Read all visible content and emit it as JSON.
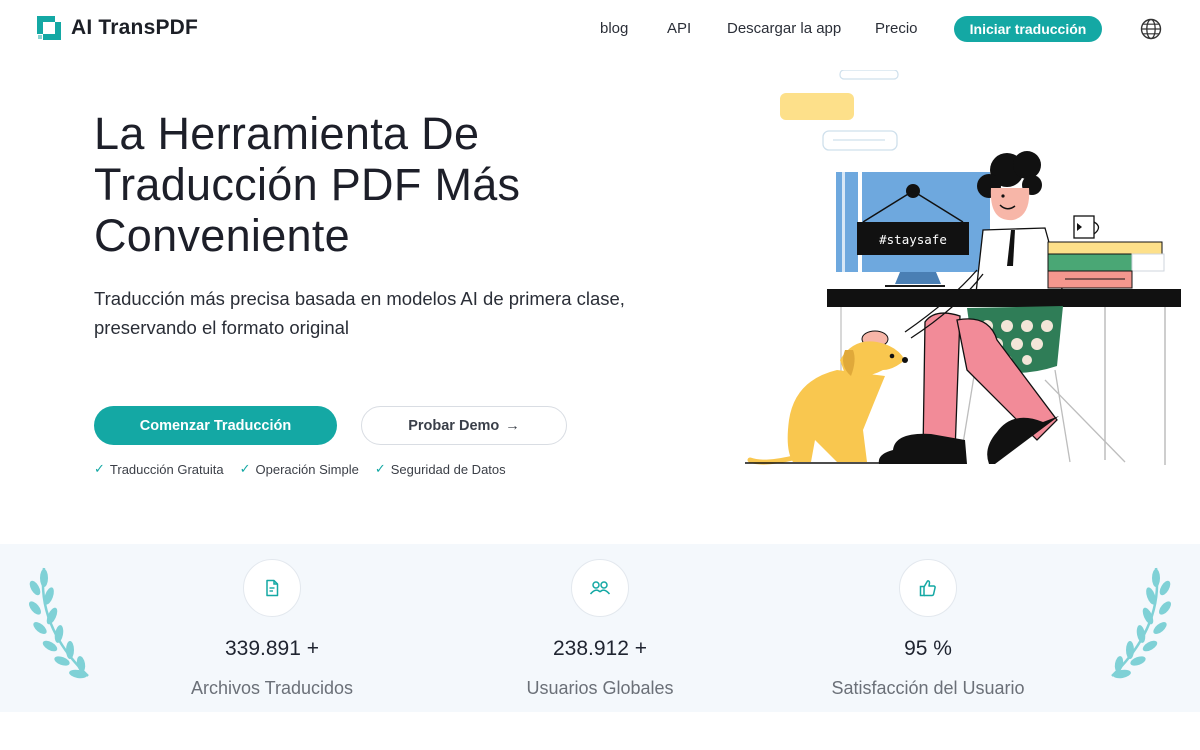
{
  "brand": {
    "name": "AI TransPDF",
    "accent": "#14a8a4"
  },
  "nav": {
    "links": [
      "blog",
      "API",
      "Descargar la app",
      "Precio"
    ],
    "cta": "Iniciar traducción",
    "language_icon": "globe-icon"
  },
  "hero": {
    "title_lines": [
      "La Herramienta De",
      "Traducción PDF Más",
      "Conveniente"
    ],
    "subtitle_lines": [
      "Traducción más precisa basada en modelos AI de primera clase,",
      "preservando el formato original"
    ],
    "primary_button": "Comenzar Traducción",
    "secondary_button": "Probar Demo",
    "secondary_arrow": "→",
    "features": [
      "Traducción Gratuita",
      "Operación Simple",
      "Seguridad de Datos"
    ],
    "illustration_sign": "#staysafe"
  },
  "stats": [
    {
      "value": "339.891 +",
      "label": "Archivos Traducidos",
      "icon": "document-icon"
    },
    {
      "value": "238.912 +",
      "label": "Usuarios Globales",
      "icon": "users-icon"
    },
    {
      "value": "95 %",
      "label": "Satisfacción del Usuario",
      "icon": "thumbs-up-icon"
    }
  ]
}
